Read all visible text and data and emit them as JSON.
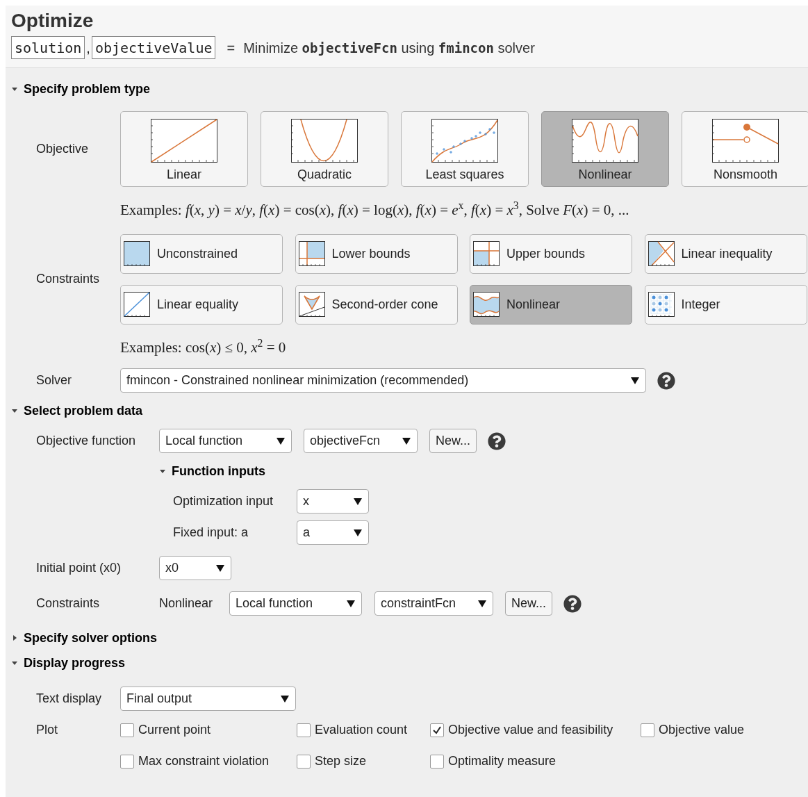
{
  "header": {
    "title": "Optimize",
    "outputs": [
      "solution",
      "objectiveValue"
    ],
    "separator": ",",
    "equals": "=",
    "description": "Minimize **objectiveFcn** using **fmincon** solver"
  },
  "problem_type": {
    "heading": "Specify problem type",
    "expanded": true,
    "objective_label": "Objective",
    "objectives": [
      {
        "kind": "linear",
        "label": "Linear",
        "selected": false
      },
      {
        "kind": "quadratic",
        "label": "Quadratic",
        "selected": false
      },
      {
        "kind": "least_squares",
        "label": "Least squares",
        "selected": false
      },
      {
        "kind": "nonlinear",
        "label": "Nonlinear",
        "selected": true
      },
      {
        "kind": "nonsmooth",
        "label": "Nonsmooth",
        "selected": false
      }
    ],
    "objective_examples": "Examples:  *f*(*x*, *y*) = *x*/*y*, *f*(*x*) = cos(*x*), *f*(*x*) = log(*x*), *f*(*x*) = *e*$^{x}$, *f*(*x*) = *x*$^{3}$, Solve *F*(*x*) = 0, ...",
    "constraints_label": "Constraints",
    "constraints": [
      {
        "kind": "unconstrained",
        "label": "Unconstrained",
        "selected": false
      },
      {
        "kind": "lower",
        "label": "Lower bounds",
        "selected": false
      },
      {
        "kind": "upper",
        "label": "Upper bounds",
        "selected": false
      },
      {
        "kind": "lin_ineq",
        "label": "Linear inequality",
        "selected": false
      },
      {
        "kind": "lin_eq",
        "label": "Linear equality",
        "selected": false
      },
      {
        "kind": "cone",
        "label": "Second-order cone",
        "selected": false
      },
      {
        "kind": "nonlinear",
        "label": "Nonlinear",
        "selected": true
      },
      {
        "kind": "integer",
        "label": "Integer",
        "selected": false
      }
    ],
    "constraint_examples": "Examples:  cos(*x*) ≤ 0, *x*$^{2}$ = 0",
    "solver_label": "Solver",
    "solver": "fmincon - Constrained nonlinear minimization (recommended)"
  },
  "problem_data": {
    "heading": "Select problem data",
    "expanded": true,
    "objective_label": "Objective function",
    "objective_source": "Local function",
    "objective_fcn": "objectiveFcn",
    "new_button": "New...",
    "function_inputs": {
      "heading": "Function inputs",
      "expanded": true,
      "rows": [
        {
          "label": "Optimization input",
          "value": "x"
        },
        {
          "label": "Fixed input: a",
          "value": "a"
        }
      ]
    },
    "initial_label": "Initial point (x0)",
    "initial_value": "x0",
    "constraints_label": "Constraints",
    "constraint_type": "Nonlinear",
    "constraint_source": "Local function",
    "constraint_fcn": "constraintFcn",
    "constraint_new_button": "New..."
  },
  "solver_options": {
    "heading": "Specify solver options",
    "expanded": false
  },
  "display_progress": {
    "heading": "Display progress",
    "expanded": true,
    "text_label": "Text display",
    "text_value": "Final output",
    "plot_label": "Plot",
    "plots": [
      {
        "label": "Current point",
        "checked": false
      },
      {
        "label": "Evaluation count",
        "checked": false
      },
      {
        "label": "Objective value and feasibility",
        "checked": true
      },
      {
        "label": "Objective value",
        "checked": false
      },
      {
        "label": "Max constraint violation",
        "checked": false
      },
      {
        "label": "Step size",
        "checked": false
      },
      {
        "label": "Optimality measure",
        "checked": false
      }
    ]
  }
}
